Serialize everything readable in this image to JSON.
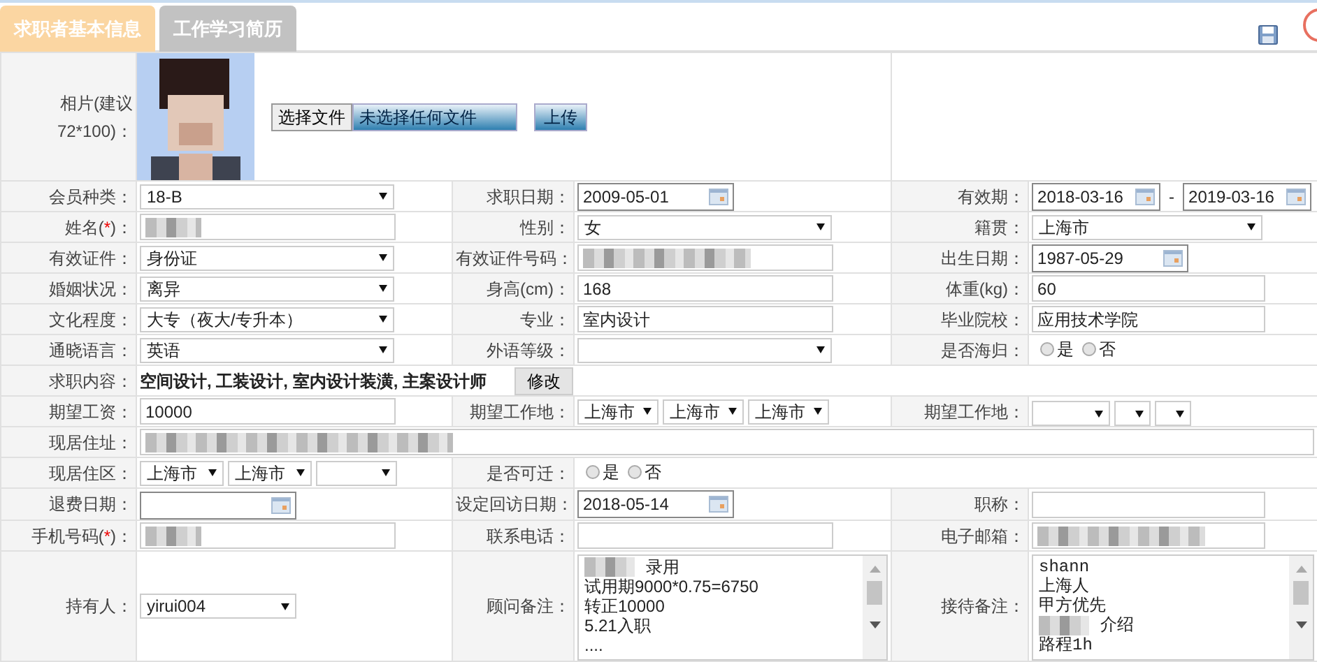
{
  "tabs": [
    {
      "label": "求职者基本信息",
      "selected": true
    },
    {
      "label": "工作学习简历",
      "selected": false
    }
  ],
  "photo": {
    "label": "相片(建议72*100)：",
    "file_button": "选择文件",
    "file_status": "未选择任何文件",
    "upload_button": "上传"
  },
  "rows": [
    {
      "fields": [
        {
          "label": "会员种类：",
          "control": {
            "kind": "select",
            "value": "18-B"
          }
        },
        {
          "label": "求职日期：",
          "control": {
            "kind": "date",
            "value": "2009-05-01"
          }
        },
        {
          "label": "有效期：",
          "control": {
            "kind": "date_range",
            "values": [
              "2018-03-16",
              "2019-03-16"
            ],
            "separator": "-"
          }
        }
      ]
    },
    {
      "fields": [
        {
          "label": "姓名(",
          "required_mark": "*",
          "label_end": ")：",
          "control": {
            "kind": "input",
            "redacted": true
          }
        },
        {
          "label": "性别：",
          "control": {
            "kind": "select",
            "value": "女"
          }
        },
        {
          "label": "籍贯：",
          "control": {
            "kind": "select",
            "value": "上海市"
          }
        }
      ]
    },
    {
      "fields": [
        {
          "label": "有效证件：",
          "control": {
            "kind": "select",
            "value": "身份证"
          }
        },
        {
          "label": "有效证件号码：",
          "control": {
            "kind": "input",
            "redacted": true
          }
        },
        {
          "label": "出生日期：",
          "control": {
            "kind": "date",
            "value": "1987-05-29"
          }
        }
      ]
    },
    {
      "fields": [
        {
          "label": "婚姻状况：",
          "control": {
            "kind": "select",
            "value": "离异"
          }
        },
        {
          "label": "身高(cm)：",
          "control": {
            "kind": "input",
            "value": "168"
          }
        },
        {
          "label": "体重(kg)：",
          "control": {
            "kind": "input",
            "value": "60"
          }
        }
      ]
    },
    {
      "fields": [
        {
          "label": "文化程度：",
          "control": {
            "kind": "select",
            "value": "大专（夜大/专升本）"
          }
        },
        {
          "label": "专业：",
          "control": {
            "kind": "input",
            "value": "室内设计"
          }
        },
        {
          "label": "毕业院校：",
          "control": {
            "kind": "input",
            "value": "应用技术学院"
          }
        }
      ]
    },
    {
      "fields": [
        {
          "label": "通晓语言：",
          "control": {
            "kind": "select",
            "value": "英语"
          }
        },
        {
          "label": "外语等级：",
          "control": {
            "kind": "select"
          }
        },
        {
          "label": "是否海归：",
          "control": {
            "kind": "radio",
            "options": [
              {
                "label": "是",
                "selected": false
              },
              {
                "label": "否",
                "selected": false
              }
            ]
          }
        }
      ]
    },
    {
      "fields": [
        {
          "label": "求职内容：",
          "control": {
            "kind": "text_button",
            "text": "空间设计, 工装设计, 室内设计装潢, 主案设计师",
            "button": "修改"
          }
        }
      ]
    },
    {
      "fields": [
        {
          "label": "期望工资：",
          "control": {
            "kind": "input",
            "value": "10000"
          }
        },
        {
          "label": "期望工作地：",
          "control": {
            "kind": "selects",
            "items": [
              {
                "value": "上海市"
              },
              {
                "value": "上海市"
              },
              {
                "value": "上海市"
              }
            ]
          }
        },
        {
          "label": "期望工作地：",
          "control": {
            "kind": "selects",
            "items": [
              {
                "empty": true
              },
              {
                "empty": true
              },
              {
                "empty": true
              }
            ]
          }
        }
      ]
    },
    {
      "fields": [
        {
          "label": "现居住址：",
          "control": {
            "kind": "input",
            "redacted": true
          }
        }
      ]
    },
    {
      "fields": [
        {
          "label": "现居住区：",
          "control": {
            "kind": "selects",
            "items": [
              {
                "value": "上海市"
              },
              {
                "value": "上海市"
              },
              {
                "empty": true
              }
            ]
          }
        },
        {
          "label": "是否可迁：",
          "control": {
            "kind": "radio",
            "options": [
              {
                "label": "是",
                "selected": false
              },
              {
                "label": "否",
                "selected": false
              }
            ]
          }
        }
      ]
    },
    {
      "fields": [
        {
          "label": "退费日期：",
          "control": {
            "kind": "date"
          }
        },
        {
          "label": "设定回访日期：",
          "control": {
            "kind": "date",
            "value": "2018-05-14"
          }
        },
        {
          "label": "职称：",
          "control": {
            "kind": "input"
          }
        }
      ]
    },
    {
      "fields": [
        {
          "label": "手机号码(",
          "required_mark": "*",
          "label_end": ")：",
          "control": {
            "kind": "input",
            "redacted": true
          }
        },
        {
          "label": "联系电话：",
          "control": {
            "kind": "input"
          }
        },
        {
          "label": "电子邮箱：",
          "control": {
            "kind": "input",
            "redacted": true
          }
        }
      ]
    },
    {
      "fields": [
        {
          "label": "持有人：",
          "control": {
            "kind": "select",
            "value": "yirui004"
          }
        },
        {
          "label": "顾问备注：",
          "control": {
            "kind": "notes",
            "lines": [
              {
                "text": "录用",
                "redacted": true
              },
              {
                "text": "试用期9000*0.75=6750"
              },
              {
                "text": "转正10000"
              },
              {
                "text": "5.21入职"
              },
              {
                "text": "...."
              }
            ]
          }
        },
        {
          "label": "接待备注：",
          "control": {
            "kind": "notes",
            "mono": true,
            "lines": [
              {
                "text": "shann"
              },
              {
                "text": "上海人"
              },
              {
                "text": "甲方优先"
              },
              {
                "text": "介绍",
                "redacted": true
              },
              {
                "text": "路程1h"
              }
            ]
          }
        }
      ]
    }
  ]
}
